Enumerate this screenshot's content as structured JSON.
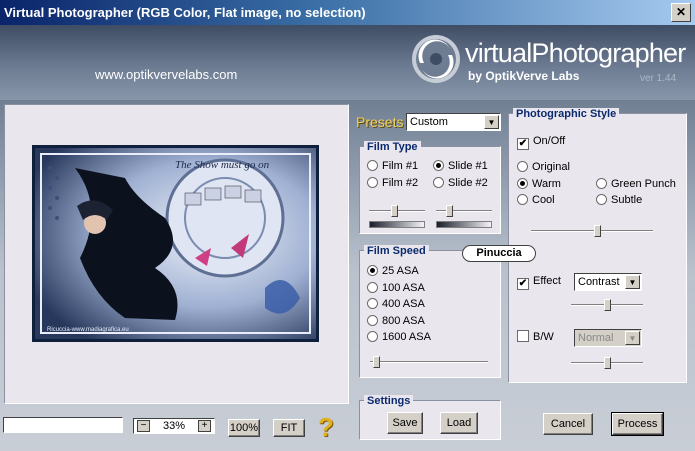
{
  "window": {
    "title": "Virtual Photographer (RGB Color, Flat image, no selection)",
    "close_glyph": "✕"
  },
  "header": {
    "url": "www.optikvervelabs.com",
    "logo_title": "virtualPhotographer",
    "logo_sub": "by OptikVerve Labs",
    "version": "ver 1.44"
  },
  "preview": {
    "watermark_text": "The Show must go on",
    "credit_text": "Ricuccia-www.madiagrafica.eu"
  },
  "bottom": {
    "zoom_minus": "−",
    "zoom_value": "33%",
    "zoom_plus": "+",
    "btn_100": "100%",
    "btn_fit": "FIT",
    "help_glyph": "?",
    "progress": 0
  },
  "presets": {
    "label": "Presets",
    "selected": "Custom"
  },
  "film_type": {
    "legend": "Film Type",
    "options": [
      "Film #1",
      "Slide #1",
      "Film #2",
      "Slide #2"
    ],
    "selected": "Slide #1",
    "slider1_value": 0.45,
    "slider2_value": 0.2
  },
  "film_speed": {
    "legend": "Film Speed",
    "options": [
      "25 ASA",
      "100 ASA",
      "400 ASA",
      "800 ASA",
      "1600 ASA"
    ],
    "selected": "25 ASA",
    "slider_value": 0.03
  },
  "settings": {
    "legend": "Settings",
    "save": "Save",
    "load": "Load"
  },
  "style": {
    "legend": "Photographic Style",
    "onoff_label": "On/Off",
    "onoff_checked": true,
    "options": [
      "Original",
      "Warm",
      "Green Punch",
      "Cool",
      "Subtle"
    ],
    "selected": "Warm",
    "style_slider_value": 0.55,
    "effect_label": "Effect",
    "effect_checked": true,
    "effect_select": "Contrast",
    "effect_slider_value": 0.5,
    "bw_label": "B/W",
    "bw_checked": false,
    "bw_select": "Normal",
    "bw_slider_value": 0.5,
    "check_glyph": "✔"
  },
  "author_tag": "Pinuccia",
  "actions": {
    "cancel": "Cancel",
    "process": "Process"
  }
}
